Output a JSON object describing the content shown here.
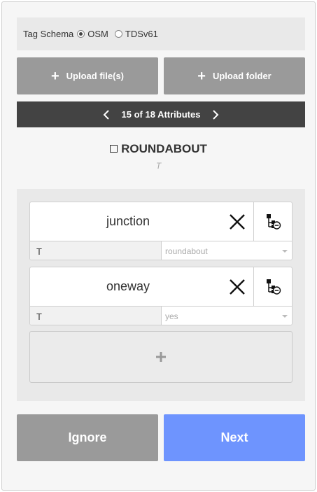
{
  "tag_schema": {
    "label": "Tag Schema",
    "options": [
      {
        "label": "OSM",
        "selected": true
      },
      {
        "label": "TDSv61",
        "selected": false
      }
    ]
  },
  "upload": {
    "files_label": "Upload file(s)",
    "folder_label": "Upload folder"
  },
  "pager": {
    "count_label": "15 of 18 Attributes"
  },
  "attribute": {
    "name": "ROUNDABOUT",
    "type": "T"
  },
  "tags": [
    {
      "key": "junction",
      "type": "T",
      "value": "roundabout"
    },
    {
      "key": "oneway",
      "type": "T",
      "value": "yes"
    }
  ],
  "add_tag": {
    "symbol": "+"
  },
  "actions": {
    "ignore_label": "Ignore",
    "next_label": "Next"
  },
  "icons": {
    "prev": "chevron-left-icon",
    "next": "chevron-right-icon",
    "remove": "close-icon",
    "tree": "tree-remove-icon",
    "plus": "plus-icon"
  },
  "colors": {
    "next_button": "#6e94fe",
    "neutral_button": "#9a9a9a",
    "pager_bg": "#434343"
  }
}
